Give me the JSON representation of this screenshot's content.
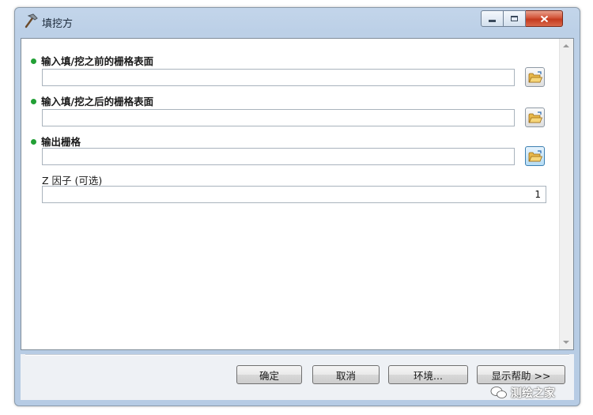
{
  "window": {
    "title": "填挖方"
  },
  "params": [
    {
      "label": "输入填/挖之前的栅格表面",
      "value": "",
      "required": true
    },
    {
      "label": "输入填/挖之后的栅格表面",
      "value": "",
      "required": true
    },
    {
      "label": "输出栅格",
      "value": "",
      "required": true
    }
  ],
  "z_factor": {
    "label": "Z 因子 (可选)",
    "value": "1"
  },
  "buttons": {
    "ok": "确定",
    "cancel": "取消",
    "environments": "环境...",
    "show_help": "显示帮助 >>"
  },
  "watermark": {
    "text": "测绘之家"
  },
  "colors": {
    "required_dot": "#22a035",
    "title_bar": "#bcd0e7",
    "close_button": "#c43a1f"
  }
}
